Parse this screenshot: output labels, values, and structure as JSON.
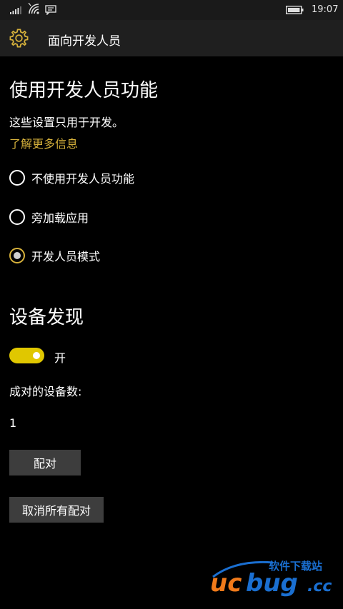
{
  "status_bar": {
    "time": "19:07",
    "icons": [
      "signal-icon",
      "wifi-icon",
      "message-icon",
      "battery-icon"
    ]
  },
  "header": {
    "icon": "gear-icon",
    "title": "面向开发人员"
  },
  "section_dev": {
    "heading": "使用开发人员功能",
    "description": "这些设置只用于开发。",
    "learn_more": "了解更多信息",
    "options": [
      {
        "label": "不使用开发人员功能",
        "checked": false
      },
      {
        "label": "旁加载应用",
        "checked": false
      },
      {
        "label": "开发人员模式",
        "checked": true
      }
    ]
  },
  "section_discovery": {
    "heading": "设备发现",
    "toggle_label": "开",
    "toggle_on": true,
    "paired_label": "成对的设备数:",
    "paired_count": "1",
    "pair_button": "配对",
    "unpair_all_button": "取消所有配对"
  },
  "watermark": {
    "brand": "ucbug",
    "suffix": ".cc",
    "tagline": "软件下载站"
  },
  "colors": {
    "accent": "#d6b13b",
    "toggle": "#e0c700",
    "background": "#000000",
    "header_bg": "#1f1f1f",
    "button_bg": "#3d3d3d"
  }
}
